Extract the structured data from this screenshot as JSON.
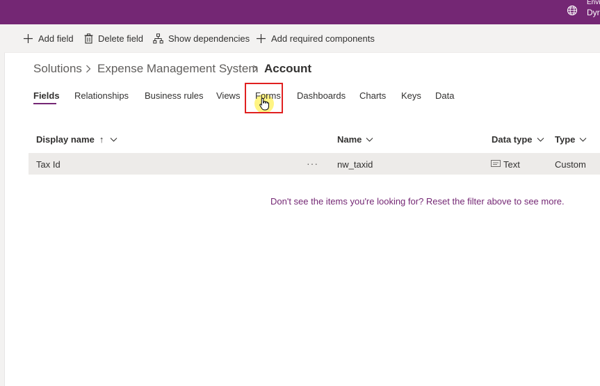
{
  "colors": {
    "brand": "#742774",
    "command_bg": "#f3f2f1",
    "row_selected_bg": "#edebe9",
    "highlight": "#e02020"
  },
  "topbar": {
    "env_label": "Envi",
    "env_name": "Dyr",
    "env_icon": "globe-icon"
  },
  "command_bar": {
    "add_field": "Add field",
    "delete_field": "Delete field",
    "show_dependencies": "Show dependencies",
    "add_required_components": "Add required components"
  },
  "breadcrumb": {
    "root": "Solutions",
    "solution": "Expense Management System",
    "current": "Account"
  },
  "tabs": [
    "Fields",
    "Relationships",
    "Business rules",
    "Views",
    "Forms",
    "Dashboards",
    "Charts",
    "Keys",
    "Data"
  ],
  "active_tab": "Fields",
  "grid": {
    "columns": {
      "display_name": "Display name",
      "sort_arrow": "↑",
      "name": "Name",
      "data_type": "Data type",
      "type": "Type"
    },
    "rows": [
      {
        "display_name": "Tax Id",
        "more": "···",
        "name": "nw_taxid",
        "data_type": "Text",
        "type": "Custom"
      }
    ]
  },
  "empty_hint": "Don't see the items you're looking for? Reset the filter above to see more."
}
